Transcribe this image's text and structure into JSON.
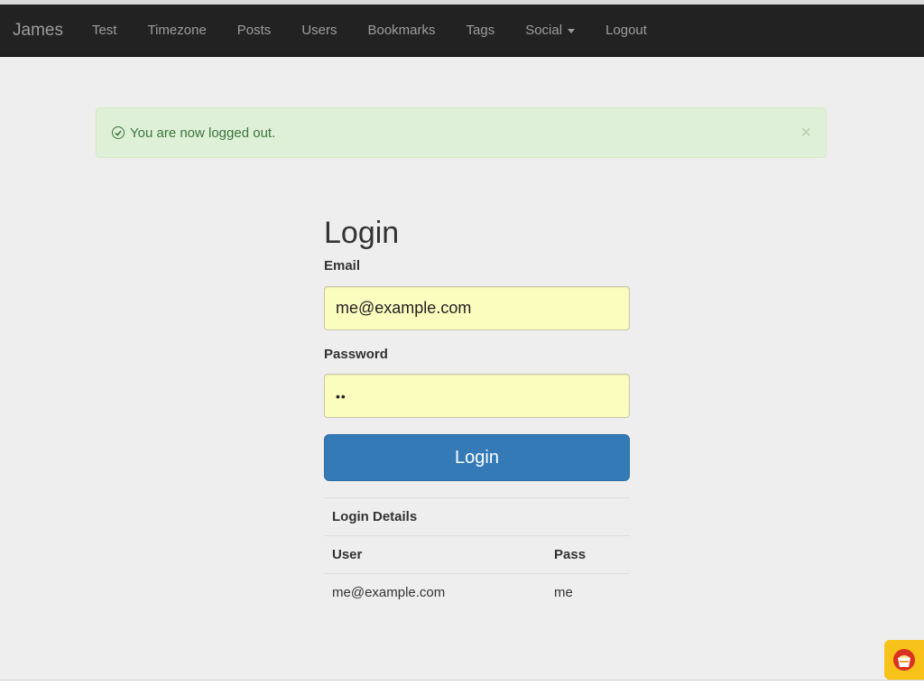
{
  "navbar": {
    "brand": "James",
    "items": [
      {
        "label": "Test"
      },
      {
        "label": "Timezone"
      },
      {
        "label": "Posts"
      },
      {
        "label": "Users"
      },
      {
        "label": "Bookmarks"
      },
      {
        "label": "Tags"
      },
      {
        "label": "Social",
        "dropdown": true
      },
      {
        "label": "Logout"
      }
    ]
  },
  "alert": {
    "message": "You are now logged out.",
    "icon": "check-circle-icon",
    "close_label": "×",
    "color": "#3c763d",
    "background": "#dff0d8"
  },
  "login": {
    "title": "Login",
    "email_label": "Email",
    "email_value": "me@example.com",
    "password_label": "Password",
    "password_value": "••",
    "submit_label": "Login",
    "accent": "#337ab7"
  },
  "details": {
    "caption": "Login Details",
    "columns": [
      "User",
      "Pass"
    ],
    "rows": [
      [
        "me@example.com",
        "me"
      ]
    ]
  },
  "helper_badge": {
    "icon": "cake-helper-icon",
    "color": "#f7c21a"
  }
}
